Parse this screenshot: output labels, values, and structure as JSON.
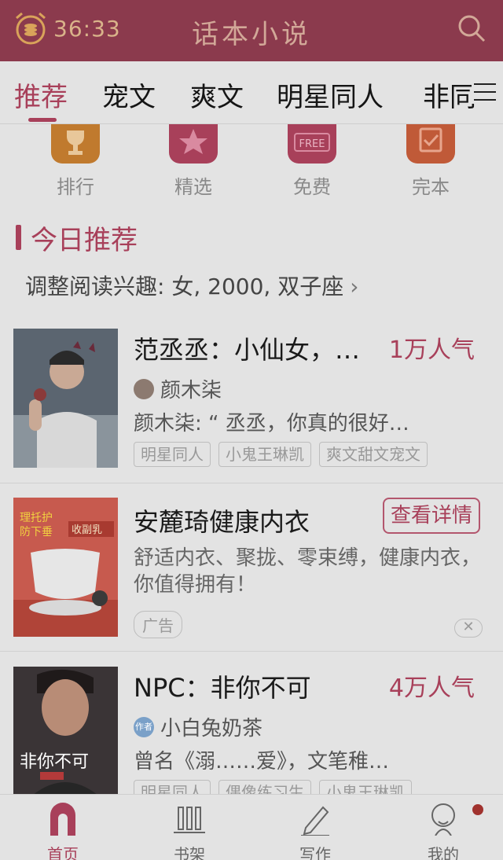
{
  "header": {
    "timer": "36:33",
    "title": "话本小说"
  },
  "tabs": [
    {
      "label": "推荐",
      "active": true
    },
    {
      "label": "宠文"
    },
    {
      "label": "爽文"
    },
    {
      "label": "明星同人"
    },
    {
      "label": "非同"
    }
  ],
  "quick_links": [
    {
      "label": "排行",
      "icon": "trophy-icon",
      "color": "#c07a2e"
    },
    {
      "label": "精选",
      "icon": "star-icon",
      "color": "#a8405a"
    },
    {
      "label": "免费",
      "icon": "free-icon",
      "color": "#a8405a",
      "badge": "FREE"
    },
    {
      "label": "完本",
      "icon": "check-icon",
      "color": "#c05a38"
    }
  ],
  "section": {
    "title": "今日推荐",
    "interest": "调整阅读兴趣: 女, 2000, 双子座"
  },
  "books": [
    {
      "title": "范丞丞：小仙女，…",
      "popularity": "1万人气",
      "author": "颜木柒",
      "desc": "颜木柒: “ 丞丞，你真的很好…",
      "tags": [
        "明星同人",
        "小鬼王琳凯",
        "爽文甜文宠文"
      ]
    },
    {
      "title": "NPC：非你不可",
      "popularity": "4万人气",
      "author": "小白兔奶茶",
      "author_badge": "作者",
      "desc": "曾名《溺……爱》，文笔稚…",
      "tags": [
        "明星同人",
        "偶像练习生",
        "小鬼王琳凯"
      ]
    }
  ],
  "ad": {
    "title": "安麓琦健康内衣",
    "button": "查看详情",
    "desc": "舒适内衣、聚拢、零束缚，健康内衣，你值得拥有！",
    "tag": "广告",
    "close": "✕",
    "cover_text_1": "理托护",
    "cover_text_2": "防下垂",
    "cover_text_3": "收副乳"
  },
  "cover2_text": "非你不可",
  "bottom_nav": [
    {
      "label": "首页",
      "icon": "home-icon",
      "active": true
    },
    {
      "label": "书架",
      "icon": "bookshelf-icon"
    },
    {
      "label": "写作",
      "icon": "pencil-icon"
    },
    {
      "label": "我的",
      "icon": "profile-icon"
    }
  ]
}
